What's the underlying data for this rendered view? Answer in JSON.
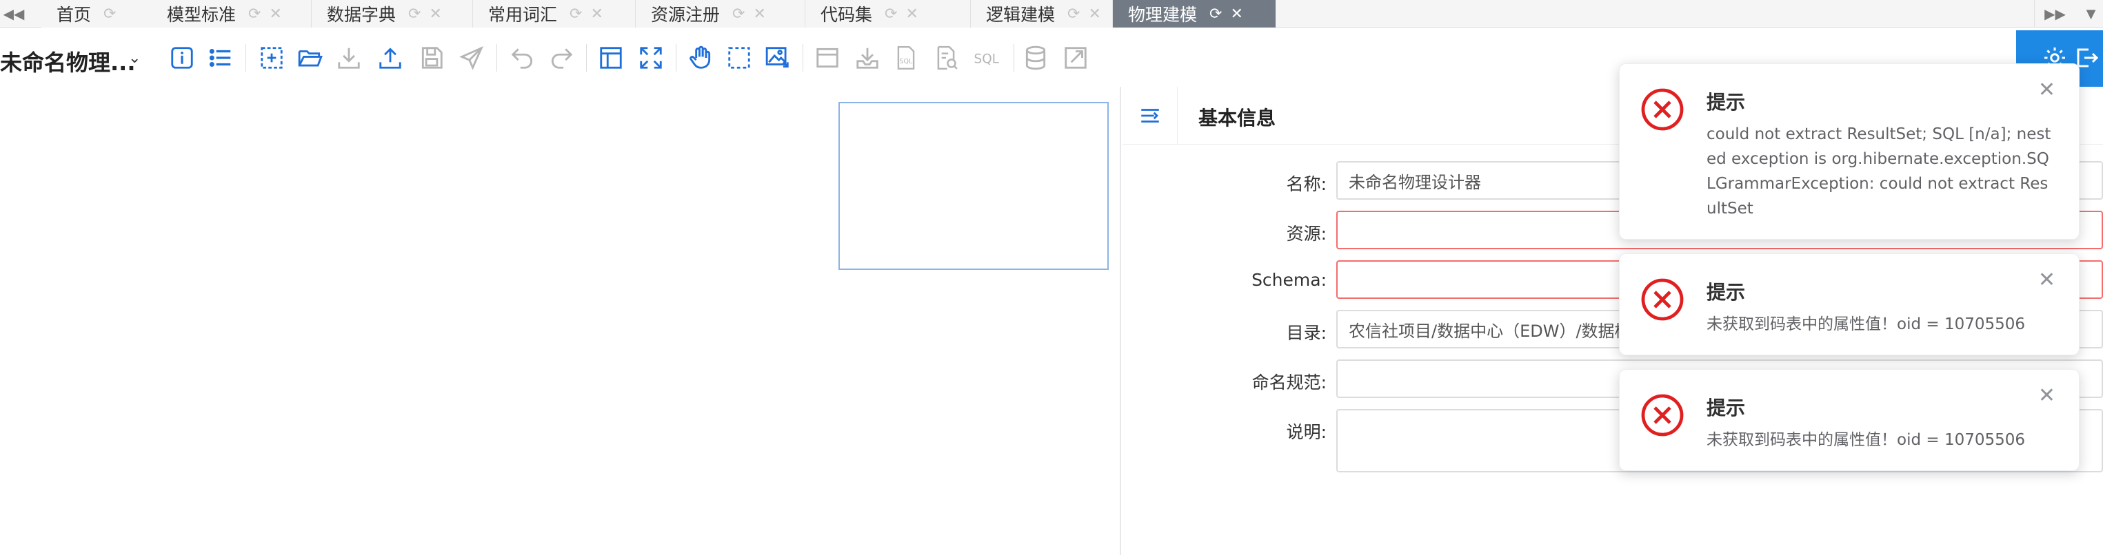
{
  "tabs": [
    {
      "label": "首页",
      "active": false
    },
    {
      "label": "模型标准",
      "active": false
    },
    {
      "label": "数据字典",
      "active": false
    },
    {
      "label": "常用词汇",
      "active": false
    },
    {
      "label": "资源注册",
      "active": false
    },
    {
      "label": "代码集",
      "active": false
    },
    {
      "label": "逻辑建模",
      "active": false
    },
    {
      "label": "物理建模",
      "active": true
    }
  ],
  "toolbar": {
    "doc_title": "未命名物理...",
    "icons": [
      "info-icon",
      "list-icon",
      "add-selection-icon",
      "open-folder-icon",
      "download-icon",
      "upload-icon",
      "save-icon",
      "send-icon",
      "undo-icon",
      "redo-icon",
      "layout-icon",
      "fullscreen-icon",
      "hand-pan-icon",
      "select-area-icon",
      "export-image-icon",
      "window-icon",
      "import-icon",
      "sql-file-icon",
      "sql-preview-icon",
      "sql-text-icon",
      "database-icon",
      "external-link-icon"
    ],
    "corner_icons": [
      "settings-icon",
      "logout-icon"
    ],
    "accent_color": "#1e88e5"
  },
  "panel": {
    "title": "基本信息",
    "fields": [
      {
        "label": "名称:",
        "value": "未命名物理设计器",
        "error": false
      },
      {
        "label": "资源:",
        "value": "",
        "error": true
      },
      {
        "label": "Schema:",
        "value": "",
        "error": true
      },
      {
        "label": "目录:",
        "value": "农信社项目/数据中心（EDW）/数据模型/物理设计",
        "error": false
      },
      {
        "label": "命名规范:",
        "value": "",
        "error": false
      },
      {
        "label": "说明:",
        "value": "",
        "error": false
      }
    ]
  },
  "notifications": [
    {
      "title": "提示",
      "message": "could not extract ResultSet; SQL [n/a]; nested exception is org.hibernate.exception.SQLGrammarException: could not extract ResultSet"
    },
    {
      "title": "提示",
      "message": "未获取到码表中的属性值！oid = 10705506"
    },
    {
      "title": "提示",
      "message": "未获取到码表中的属性值！oid = 10705506"
    }
  ],
  "colors": {
    "error": "#e02020",
    "error_border": "#f56c6c",
    "active_tab": "#727b85"
  }
}
